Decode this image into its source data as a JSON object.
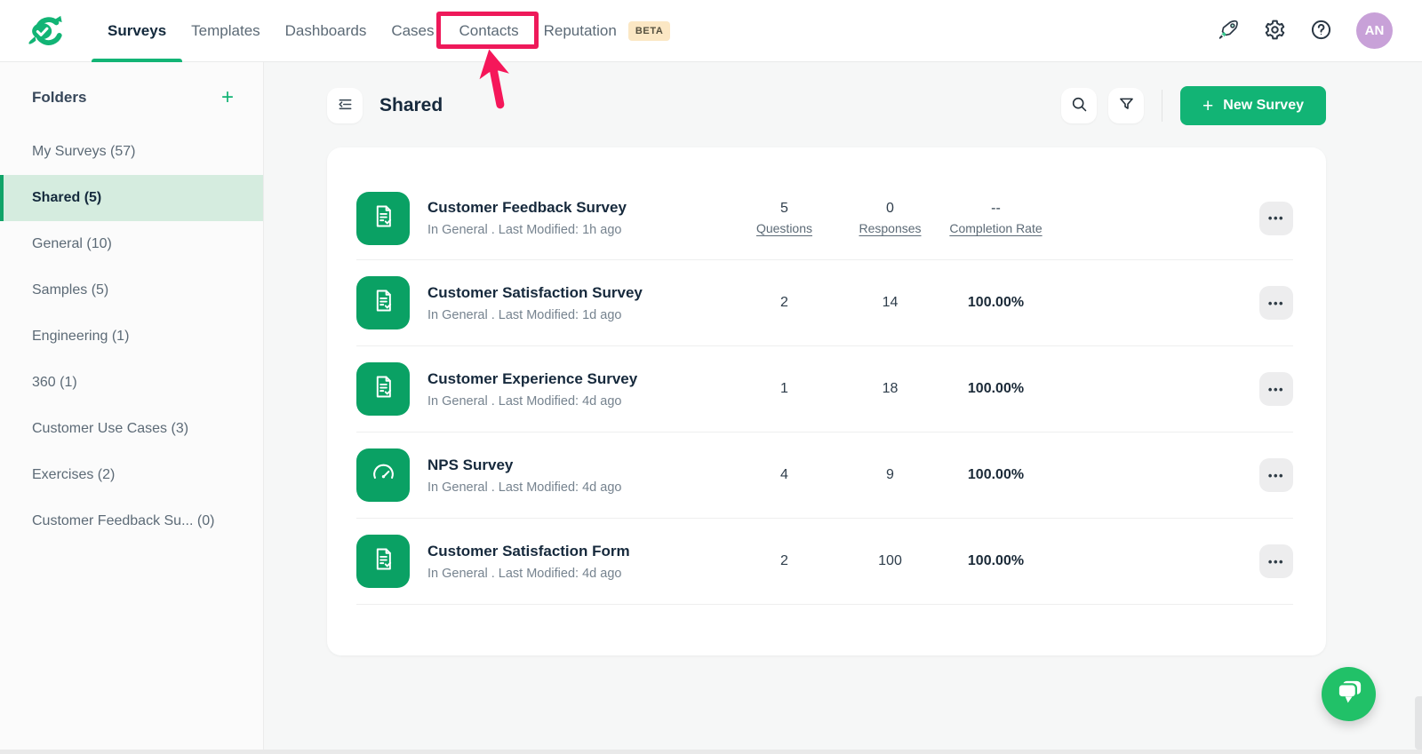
{
  "nav": {
    "items": [
      {
        "label": "Surveys",
        "active": true
      },
      {
        "label": "Templates"
      },
      {
        "label": "Dashboards"
      },
      {
        "label": "Cases"
      },
      {
        "label": "Contacts",
        "highlighted": true
      },
      {
        "label": "Reputation",
        "badge": "BETA"
      }
    ],
    "avatar_initials": "AN"
  },
  "sidebar": {
    "title": "Folders",
    "add_label": "+",
    "items": [
      {
        "label": "My Surveys (57)"
      },
      {
        "label": "Shared (5)",
        "active": true
      },
      {
        "label": "General (10)"
      },
      {
        "label": "Samples (5)"
      },
      {
        "label": "Engineering (1)"
      },
      {
        "label": "360 (1)"
      },
      {
        "label": "Customer Use Cases (3)"
      },
      {
        "label": "Exercises (2)"
      },
      {
        "label": "Customer Feedback Su... (0)"
      }
    ]
  },
  "header": {
    "title": "Shared",
    "plus": "+",
    "new_survey_label": "New Survey"
  },
  "surveys": {
    "stat_labels": {
      "questions": "Questions",
      "responses": "Responses",
      "completion": "Completion Rate"
    },
    "more_label": "•••",
    "rows": [
      {
        "title": "Customer Feedback Survey",
        "meta": "In General . Last Modified: 1h ago",
        "questions": "5",
        "responses": "0",
        "completion": "--",
        "icon": "document-check"
      },
      {
        "title": "Customer Satisfaction Survey",
        "meta": "In General . Last Modified: 1d ago",
        "questions": "2",
        "responses": "14",
        "completion": "100.00%",
        "icon": "document-check"
      },
      {
        "title": "Customer Experience Survey",
        "meta": "In General . Last Modified: 4d ago",
        "questions": "1",
        "responses": "18",
        "completion": "100.00%",
        "icon": "document-check"
      },
      {
        "title": "NPS Survey",
        "meta": "In General . Last Modified: 4d ago",
        "questions": "4",
        "responses": "9",
        "completion": "100.00%",
        "icon": "nps-gauge"
      },
      {
        "title": "Customer Satisfaction Form",
        "meta": "In General . Last Modified: 4d ago",
        "questions": "2",
        "responses": "100",
        "completion": "100.00%",
        "icon": "document-check"
      }
    ]
  },
  "annotation": {
    "target": "Contacts",
    "color": "#ee195a"
  },
  "colors": {
    "accent_green": "#12b475",
    "row_icon_green": "#0aa164",
    "active_item_bg": "#d5ecdf",
    "beta_bg": "#fbe7c4",
    "avatar_bg": "#c8a1d8",
    "chat_green": "#21c168",
    "annotation_red": "#ee195a"
  }
}
